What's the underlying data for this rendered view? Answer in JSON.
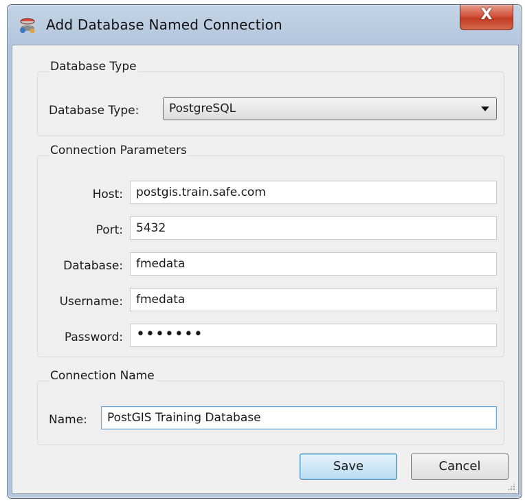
{
  "window": {
    "title": "Add Database Named Connection",
    "close_label": "X"
  },
  "database_type_group": {
    "title": "Database Type",
    "label": "Database Type:",
    "selected": "PostgreSQL"
  },
  "connection_params_group": {
    "title": "Connection Parameters",
    "fields": [
      {
        "label": "Host:",
        "value": "postgis.train.safe.com"
      },
      {
        "label": "Port:",
        "value": "5432"
      },
      {
        "label": "Database:",
        "value": "fmedata"
      },
      {
        "label": "Username:",
        "value": "fmedata"
      },
      {
        "label": "Password:",
        "value": "•••••••"
      }
    ]
  },
  "connection_name_group": {
    "title": "Connection Name",
    "label": "Name:",
    "value": "PostGIS Training Database"
  },
  "buttons": {
    "save": "Save",
    "cancel": "Cancel"
  }
}
